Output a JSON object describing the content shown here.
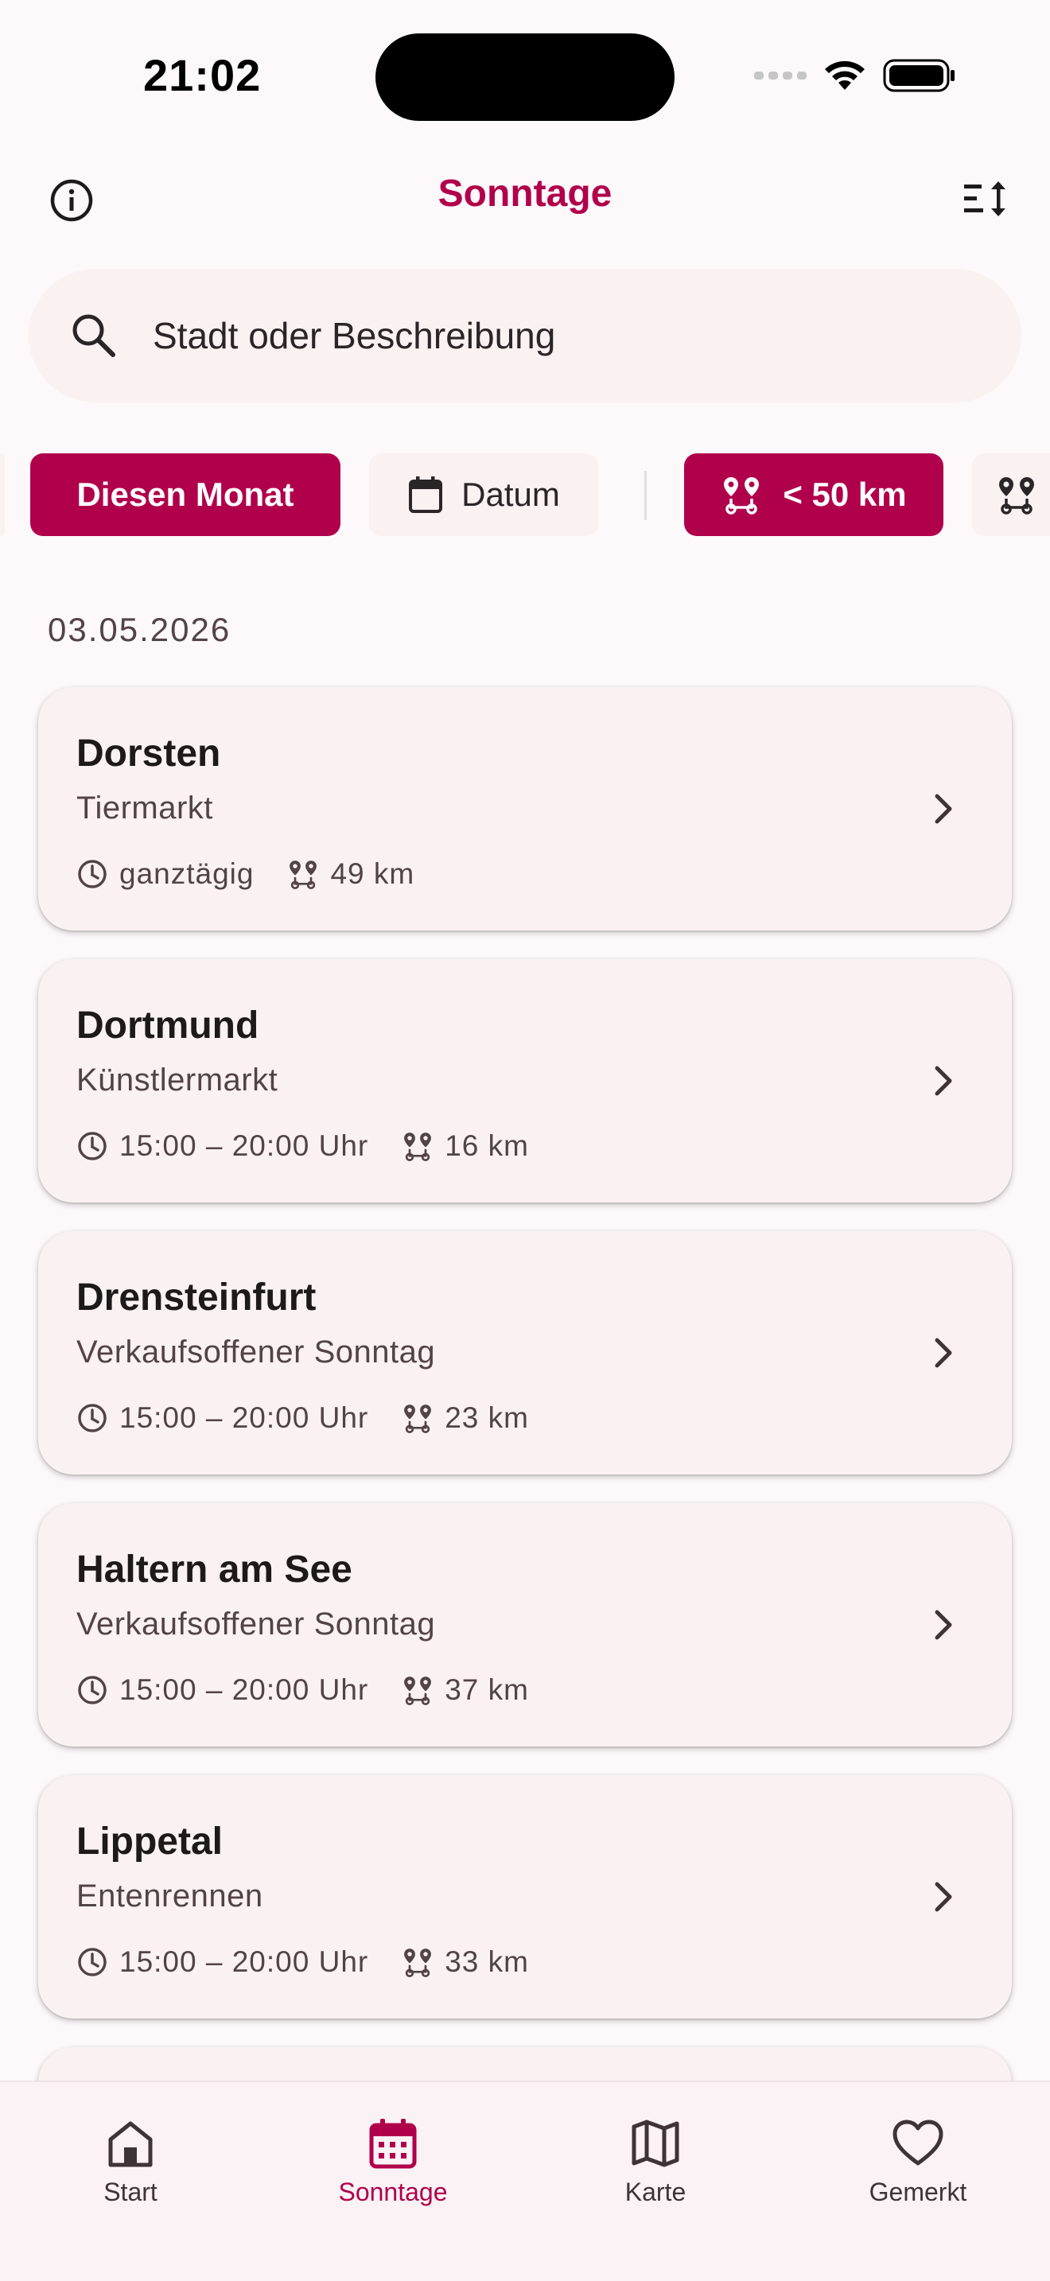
{
  "status_bar": {
    "time": "21:02"
  },
  "app_bar": {
    "title": "Sonntage"
  },
  "search": {
    "placeholder": "Stadt oder Beschreibung"
  },
  "filters": {
    "this_month": "Diesen Monat",
    "date": "Datum",
    "distance": "< 50 km"
  },
  "section": {
    "date": "03.05.2026"
  },
  "events": [
    {
      "city": "Dorsten",
      "title": "Tiermarkt",
      "time": "ganztägig",
      "distance": "49 km"
    },
    {
      "city": "Dortmund",
      "title": "Künstlermarkt",
      "time": "15:00 – 20:00 Uhr",
      "distance": "16 km"
    },
    {
      "city": "Drensteinfurt",
      "title": "Verkaufsoffener Sonntag",
      "time": "15:00 – 20:00 Uhr",
      "distance": "23 km"
    },
    {
      "city": "Haltern am See",
      "title": "Verkaufsoffener Sonntag",
      "time": "15:00 – 20:00 Uhr",
      "distance": "37 km"
    },
    {
      "city": "Lippetal",
      "title": "Entenrennen",
      "time": "15:00 – 20:00 Uhr",
      "distance": "33 km"
    }
  ],
  "bottom_nav": {
    "start": "Start",
    "sonntage": "Sonntage",
    "karte": "Karte",
    "gemerkt": "Gemerkt"
  },
  "colors": {
    "accent": "#B1004B",
    "background": "#FDF8FA",
    "surface": "#FAF2F2",
    "text": "#1E1A1B",
    "text_secondary": "#524347"
  },
  "icons": {
    "info": "info-icon",
    "sort": "sort-icon",
    "search": "search-icon",
    "calendar": "calendar-icon",
    "route": "route-icon",
    "clock": "clock-icon",
    "chevron": "chevron-right-icon",
    "home": "home-icon",
    "map": "map-icon",
    "heart": "heart-icon"
  }
}
